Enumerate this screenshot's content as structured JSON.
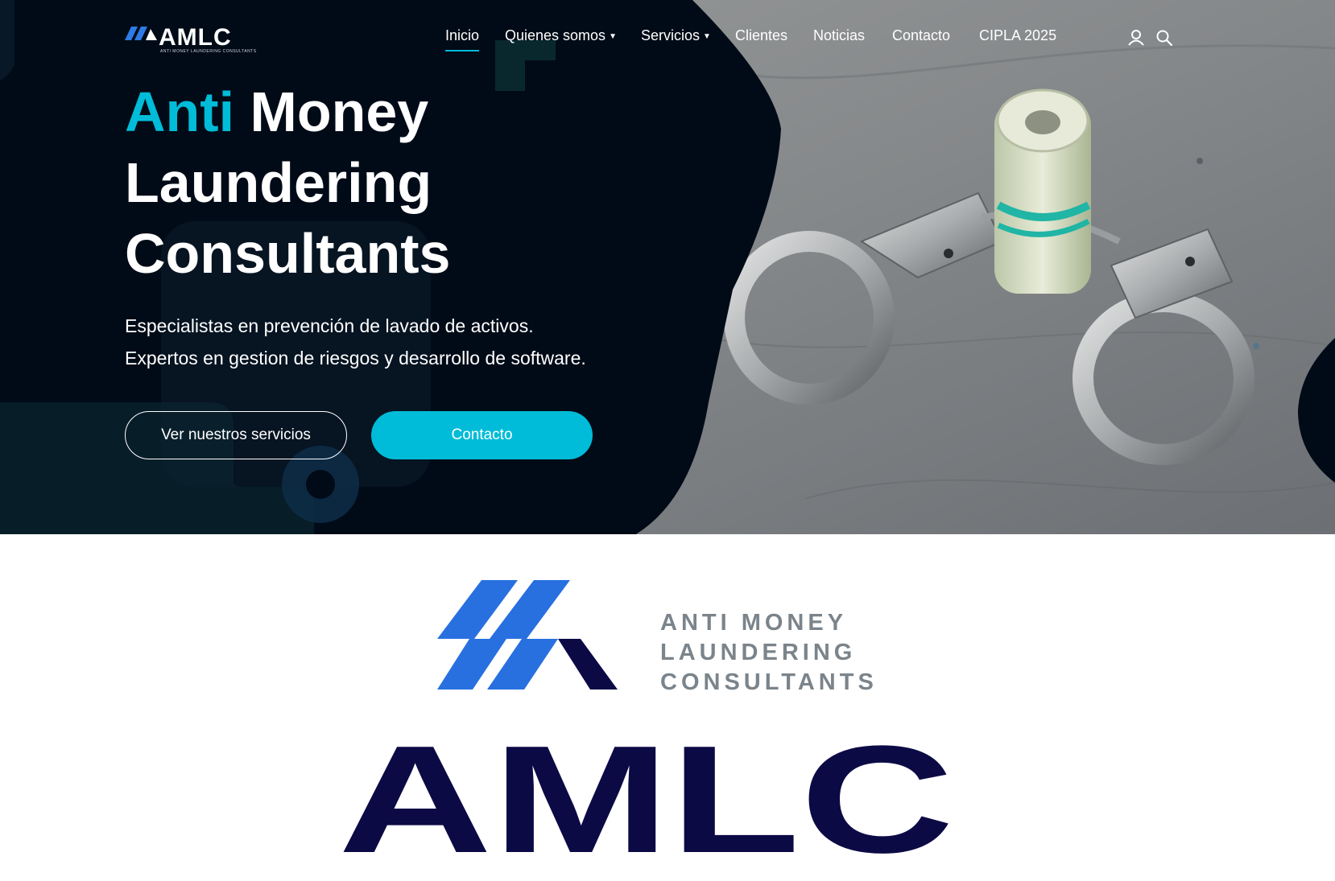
{
  "brand": {
    "logo_text": "AMLC",
    "logo_subtitle": "ANTI MONEY LAUNDERING CONSULTANTS"
  },
  "nav": {
    "items": [
      {
        "label": "Inicio",
        "active": true
      },
      {
        "label": "Quienes somos",
        "dropdown": true
      },
      {
        "label": "Servicios",
        "dropdown": true
      },
      {
        "label": "Clientes"
      },
      {
        "label": "Noticias"
      },
      {
        "label": "Contacto"
      },
      {
        "label": "CIPLA 2025"
      }
    ],
    "icons": [
      "user-icon",
      "search-icon"
    ]
  },
  "hero": {
    "title_accent": "Anti",
    "title_bold": "Money",
    "title_line2": "Laundering",
    "title_line3": "Consultants",
    "subtitle_line1": "Especialistas en prevención de lavado de activos.",
    "subtitle_line2": "Expertos en gestion de riesgos y desarrollo de software.",
    "button_services": "Ver nuestros servicios",
    "button_contact": "Contacto"
  },
  "logo": {
    "tagline_line1": "ANTI MONEY",
    "tagline_line2": "LAUNDERING",
    "tagline_line3": "CONSULTANTS",
    "wordmark": "AMLC"
  },
  "colors": {
    "dark_navy": "#010b17",
    "accent_cyan": "#00bcd8",
    "logo_blue": "#2870e0",
    "logo_navy": "#0c0a45",
    "tagline_gray": "#7b848b"
  }
}
